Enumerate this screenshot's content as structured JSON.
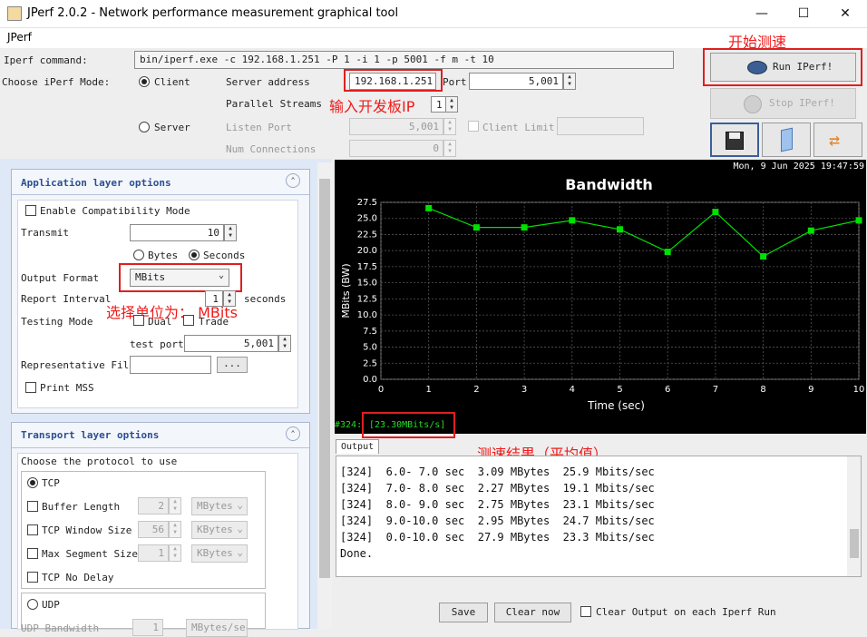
{
  "window": {
    "title": "JPerf 2.0.2 - Network performance measurement graphical tool",
    "minimize": "—",
    "maximize": "☐",
    "close": "✕"
  },
  "menu": {
    "item": "JPerf"
  },
  "command": {
    "label": "Iperf command:",
    "value": "bin/iperf.exe -c 192.168.1.251 -P 1 -i 1 -p 5001 -f m -t 10"
  },
  "mode": {
    "label": "Choose iPerf Mode:",
    "client": "Client",
    "server": "Server",
    "server_address_label": "Server address",
    "server_address": "192.168.1.251",
    "port_label": "Port",
    "port": "5,001",
    "parallel_label": "Parallel Streams",
    "parallel": "1",
    "listen_port_label": "Listen Port",
    "listen_port": "5,001",
    "client_limit_label": "Client Limit",
    "num_conn_label": "Num Connections",
    "num_conn": "0"
  },
  "buttons": {
    "run": "Run IPerf!",
    "stop": "Stop IPerf!"
  },
  "annotations": {
    "start": "开始测速",
    "input_ip": "输入开发板IP",
    "unit": "选择单位为： MBits",
    "result": "测速结果（平均值）"
  },
  "app_layer": {
    "title": "Application layer options",
    "compat": "Enable Compatibility Mode",
    "transmit_label": "Transmit",
    "transmit": "10",
    "bytes": "Bytes",
    "seconds": "Seconds",
    "output_format_label": "Output Format",
    "output_format": "MBits",
    "report_interval_label": "Report Interval",
    "report_interval": "1",
    "seconds_unit": "seconds",
    "testing_mode_label": "Testing Mode",
    "dual": "Dual",
    "trade": "Trade",
    "test_port_label": "test port",
    "test_port": "5,001",
    "rep_file_label": "Representative File",
    "browse": "...",
    "print_mss": "Print MSS"
  },
  "transport": {
    "title": "Transport layer options",
    "protocol_label": "Choose the protocol to use",
    "tcp": "TCP",
    "buffer_length": "Buffer Length",
    "buffer_value": "2",
    "buffer_unit": "MBytes",
    "window_size": "TCP Window Size",
    "window_value": "56",
    "window_unit": "KBytes",
    "mss": "Max Segment Size",
    "mss_value": "1",
    "mss_unit": "KBytes",
    "nodelay": "TCP No Delay",
    "udp": "UDP",
    "udp_bw": "UDP Bandwidth",
    "udp_bw_value": "1",
    "udp_bw_unit": "MBytes/sec"
  },
  "graph": {
    "timestamp": "Mon, 9 Jun 2025 19:47:59",
    "status_id": "#324:",
    "status_value": "[23.30MBits/s]"
  },
  "chart_data": {
    "type": "line",
    "title": "Bandwidth",
    "xlabel": "Time (sec)",
    "ylabel": "MBits (BW)",
    "xlim": [
      0,
      10
    ],
    "ylim": [
      0,
      27.5
    ],
    "xticks": [
      "0",
      "1",
      "2",
      "3",
      "4",
      "5",
      "6",
      "7",
      "8",
      "9",
      "10"
    ],
    "yticks": [
      "0.0",
      "2.5",
      "5.0",
      "7.5",
      "10.0",
      "12.5",
      "15.0",
      "17.5",
      "20.0",
      "22.5",
      "25.0",
      "27.5"
    ],
    "series": [
      {
        "x": [
          1,
          2,
          3,
          4,
          5,
          6,
          7,
          8,
          9,
          10
        ],
        "values": [
          26.6,
          23.6,
          23.6,
          24.7,
          23.3,
          19.8,
          26.0,
          19.1,
          23.1,
          24.7
        ],
        "color": "#00e000"
      }
    ],
    "grid": true,
    "background": "#000000"
  },
  "output": {
    "tab": "Output",
    "lines": [
      "[324]  6.0- 7.0 sec  3.09 MBytes  25.9 Mbits/sec",
      "[324]  7.0- 8.0 sec  2.27 MBytes  19.1 Mbits/sec",
      "[324]  8.0- 9.0 sec  2.75 MBytes  23.1 Mbits/sec",
      "[324]  9.0-10.0 sec  2.95 MBytes  24.7 Mbits/sec",
      "[324]  0.0-10.0 sec  27.9 MBytes  23.3 Mbits/sec",
      "Done."
    ],
    "save": "Save",
    "clear": "Clear now",
    "clear_each": "Clear Output on each Iperf Run"
  }
}
